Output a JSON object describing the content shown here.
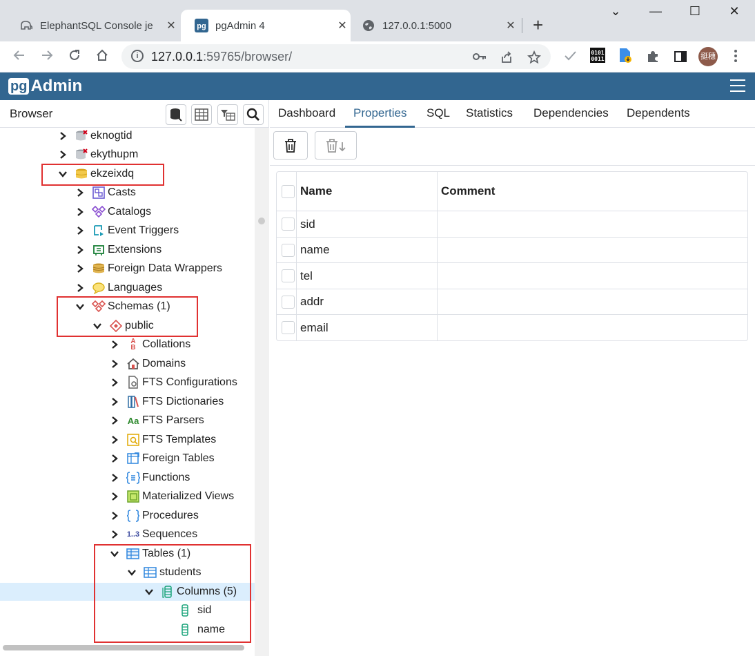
{
  "chrome": {
    "tabs": [
      {
        "title": "ElephantSQL Console je",
        "close": "✕"
      },
      {
        "title": "pgAdmin 4",
        "close": "✕"
      },
      {
        "title": "127.0.0.1:5000",
        "close": "✕"
      }
    ],
    "new_tab": "+",
    "window_controls": {
      "dropdown": "⌄",
      "minimize": "—",
      "maximize": "☐",
      "close": "✕"
    },
    "url_host": "127.0.0.1",
    "url_rest": ":59765/browser/",
    "profile_initials": "挺穗",
    "ext_binary": "0101\n0011"
  },
  "pgadmin": {
    "logo_pg": "pg",
    "logo_admin": "Admin"
  },
  "browser_panel": {
    "title": "Browser",
    "tree": [
      {
        "label": "eknogtid",
        "expanded": false,
        "icon": "database-disconnected-icon"
      },
      {
        "label": "ekythupm",
        "expanded": false,
        "icon": "database-disconnected-icon"
      },
      {
        "label": "ekzeixdq",
        "expanded": true,
        "icon": "database-icon"
      },
      {
        "label": "Casts",
        "expanded": false,
        "icon": "casts-icon"
      },
      {
        "label": "Catalogs",
        "expanded": false,
        "icon": "catalogs-icon"
      },
      {
        "label": "Event Triggers",
        "expanded": false,
        "icon": "event-triggers-icon"
      },
      {
        "label": "Extensions",
        "expanded": false,
        "icon": "extensions-icon"
      },
      {
        "label": "Foreign Data Wrappers",
        "expanded": false,
        "icon": "fdw-icon"
      },
      {
        "label": "Languages",
        "expanded": false,
        "icon": "languages-icon"
      },
      {
        "label": "Schemas (1)",
        "expanded": true,
        "icon": "schemas-icon"
      },
      {
        "label": "public",
        "expanded": true,
        "icon": "schema-icon"
      },
      {
        "label": "Collations",
        "expanded": false,
        "icon": "collations-icon"
      },
      {
        "label": "Domains",
        "expanded": false,
        "icon": "domains-icon"
      },
      {
        "label": "FTS Configurations",
        "expanded": false,
        "icon": "fts-config-icon"
      },
      {
        "label": "FTS Dictionaries",
        "expanded": false,
        "icon": "fts-dict-icon"
      },
      {
        "label": "FTS Parsers",
        "expanded": false,
        "icon": "fts-parsers-icon"
      },
      {
        "label": "FTS Templates",
        "expanded": false,
        "icon": "fts-templates-icon"
      },
      {
        "label": "Foreign Tables",
        "expanded": false,
        "icon": "foreign-tables-icon"
      },
      {
        "label": "Functions",
        "expanded": false,
        "icon": "functions-icon"
      },
      {
        "label": "Materialized Views",
        "expanded": false,
        "icon": "mviews-icon"
      },
      {
        "label": "Procedures",
        "expanded": false,
        "icon": "procedures-icon"
      },
      {
        "label": "Sequences",
        "expanded": false,
        "icon": "sequences-icon"
      },
      {
        "label": "Tables (1)",
        "expanded": true,
        "icon": "tables-icon"
      },
      {
        "label": "students",
        "expanded": true,
        "icon": "table-icon"
      },
      {
        "label": "Columns (5)",
        "expanded": true,
        "icon": "columns-icon",
        "selected": true
      },
      {
        "label": "sid",
        "icon": "column-icon"
      },
      {
        "label": "name",
        "icon": "column-icon"
      }
    ],
    "icon_text": {
      "fts_parsers": "Aa",
      "sequences": "1..3",
      "collations_a": "A",
      "collations_b": "B"
    }
  },
  "properties_panel": {
    "tabs": [
      "Dashboard",
      "Properties",
      "SQL",
      "Statistics",
      "Dependencies",
      "Dependents"
    ],
    "active_tab": "Properties",
    "columns": [
      "Name",
      "Comment"
    ],
    "rows": [
      {
        "name": "sid",
        "comment": ""
      },
      {
        "name": "name",
        "comment": ""
      },
      {
        "name": "tel",
        "comment": ""
      },
      {
        "name": "addr",
        "comment": ""
      },
      {
        "name": "email",
        "comment": ""
      }
    ]
  },
  "colors": {
    "pgadmin_blue": "#326690",
    "highlight_red": "#e03131",
    "selection": "#dbeefd"
  }
}
